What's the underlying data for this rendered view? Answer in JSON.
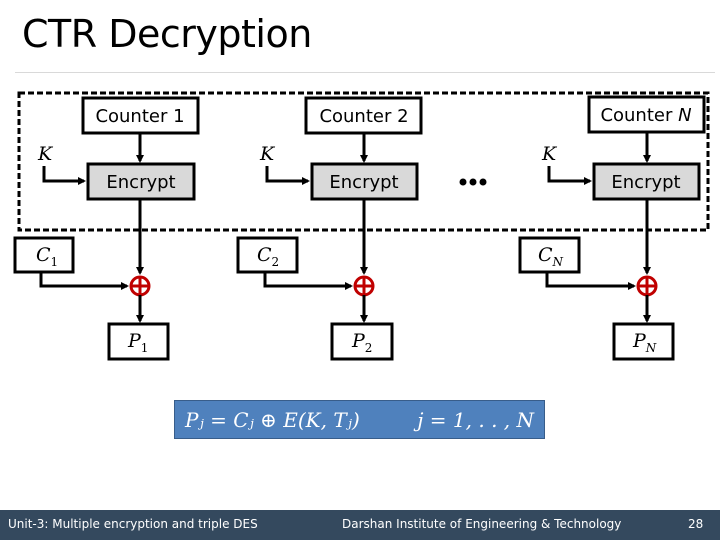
{
  "slide": {
    "title": "CTR Decryption",
    "page_number": "28"
  },
  "diagram": {
    "stages": [
      {
        "counter": "Counter 1",
        "encrypt": "Encrypt",
        "key": "K",
        "cipher_main": "C",
        "cipher_sub": "1",
        "plain_main": "P",
        "plain_sub": "1"
      },
      {
        "counter": "Counter 2",
        "encrypt": "Encrypt",
        "key": "K",
        "cipher_main": "C",
        "cipher_sub": "2",
        "plain_main": "P",
        "plain_sub": "2"
      },
      {
        "counter": "Counter ",
        "counter_italic": "N",
        "encrypt": "Encrypt",
        "key": "K",
        "cipher_main": "C",
        "cipher_sub": "N",
        "plain_main": "P",
        "plain_sub": "N"
      }
    ],
    "ellipsis": "•••",
    "xor_symbol": "⊕",
    "xor_color": "#c00000",
    "encrypt_fill": "#d9d9d9",
    "formula_fill": "#4f81bd"
  },
  "formula": {
    "lhs": "Pⱼ = Cⱼ ⊕ E(K, Tⱼ)",
    "rhs": "j = 1, . . , N"
  },
  "footer": {
    "left": "Unit-3: Multiple encryption and triple DES",
    "center": "Darshan Institute of Engineering & Technology",
    "right": "28",
    "background": "#34495e"
  }
}
